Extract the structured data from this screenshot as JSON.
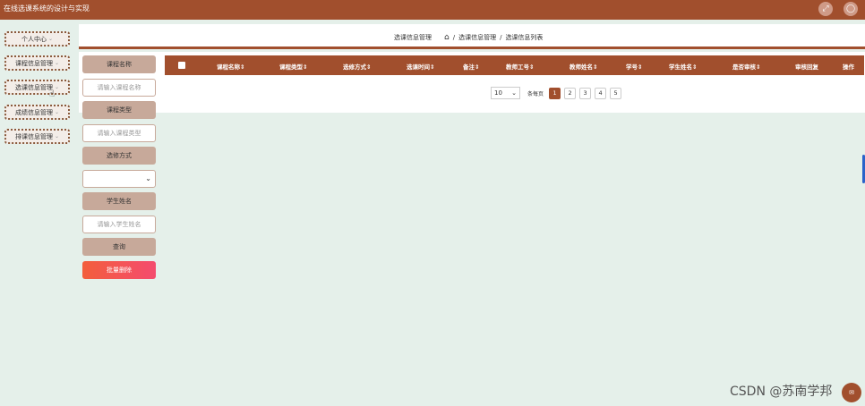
{
  "app": {
    "title": "在线选课系统的设计与实现"
  },
  "topbar": {
    "icons": [
      "fullscreen-icon",
      "user-icon"
    ]
  },
  "sidebar": {
    "items": [
      {
        "label": "个人中心"
      },
      {
        "label": "课程信息管理"
      },
      {
        "label": "选课信息管理"
      },
      {
        "label": "成绩信息管理"
      },
      {
        "label": "排课信息管理"
      }
    ]
  },
  "header": {
    "page_title": "选课信息管理",
    "breadcrumb": [
      "选课信息管理",
      "选课信息列表"
    ],
    "separator": "/"
  },
  "search": {
    "course_name_label": "课程名称",
    "course_name_placeholder": "请输入课程名称",
    "course_type_label": "课程类型",
    "course_type_placeholder": "请输入课程类型",
    "elective_label": "选修方式",
    "elective_value": "",
    "student_name_label": "学生姓名",
    "student_name_placeholder": "请输入学生姓名",
    "query_label": "查询",
    "batch_delete_label": "批量删除"
  },
  "table": {
    "columns": [
      "课程名称",
      "课程类型",
      "选修方式",
      "选课时间",
      "备注",
      "教师工号",
      "教师姓名",
      "学号",
      "学生姓名",
      "是否审核",
      "审核回复",
      "操作"
    ],
    "rows": []
  },
  "pagination": {
    "page_size": "10",
    "page_size_label": "条每页",
    "pages": [
      "1",
      "2",
      "3",
      "4",
      "5"
    ],
    "current_page": "1"
  },
  "watermark": "CSDN @苏南学邦",
  "colors": {
    "primary": "#a14f2d",
    "accent_soft": "#c7a99a",
    "background": "#e5f0ea",
    "danger_start": "#f35e3c",
    "danger_end": "#f44c6e"
  }
}
